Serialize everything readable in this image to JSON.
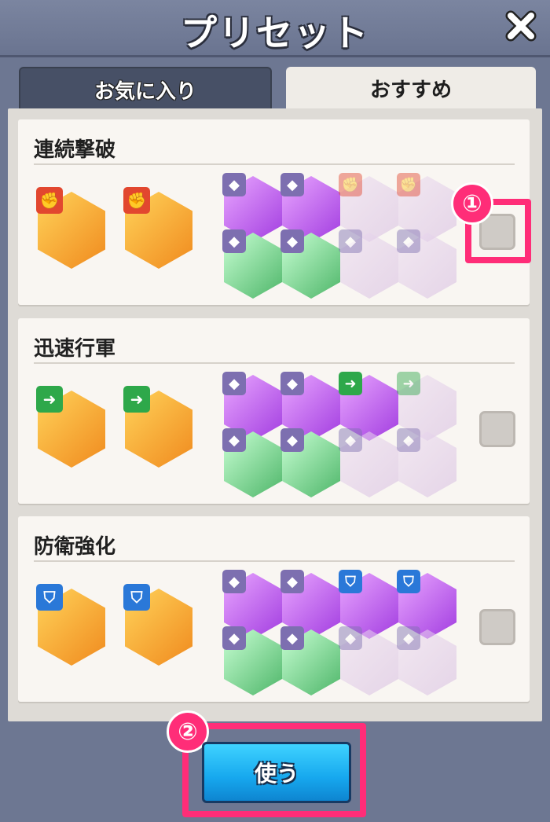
{
  "header": {
    "title": "プリセット"
  },
  "tabs": [
    {
      "label": "お気に入り",
      "active": false
    },
    {
      "label": "おすすめ",
      "active": true
    }
  ],
  "presets": [
    {
      "name": "連続撃破",
      "checked": false,
      "highlighted": true,
      "callout": "①"
    },
    {
      "name": "迅速行軍",
      "checked": false,
      "highlighted": false,
      "callout": ""
    },
    {
      "name": "防衛強化",
      "checked": false,
      "highlighted": false,
      "callout": ""
    }
  ],
  "footer": {
    "use_label": "使う",
    "callout": "②"
  },
  "colors": {
    "accent_pink": "#ff2d78",
    "attack_red": "#e2472f",
    "speed_green": "#2ea84a",
    "defense_blue": "#2a78d8",
    "rarity_purple": "#a13ad8"
  }
}
